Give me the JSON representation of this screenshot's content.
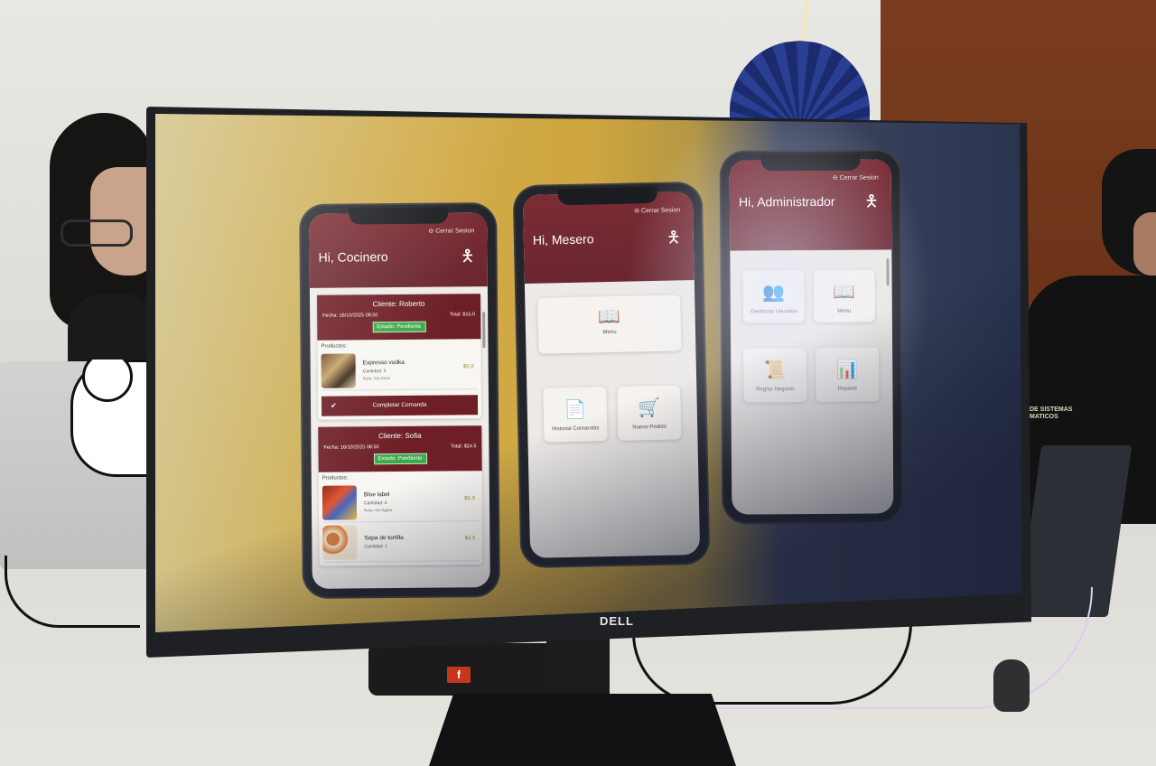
{
  "monitor": {
    "brand": "DELL"
  },
  "speaker": {
    "badge": "f"
  },
  "apparel": {
    "logo_text": "DE SISTEMAS\nMATICOS"
  },
  "phones": {
    "cocinero": {
      "logout": "Cerrar Sesion",
      "greeting": "Hi, Cocinero",
      "orders": [
        {
          "client": "Cliente: Roberto",
          "date": "Fecha: 16/10/2025 08:50",
          "total": "Total: $15.0",
          "status": "Estado: Pendiente",
          "products_label": "Productos:",
          "products": [
            {
              "name": "Expresso vodka",
              "qty": "Cantidad: 3",
              "note": "Nota: Sin limón",
              "price": "$5.0"
            }
          ],
          "complete_label": "Completar Comanda"
        },
        {
          "client": "Cliente: Sofia",
          "date": "Fecha: 16/10/2025 08:50",
          "total": "Total: $24.5",
          "status": "Estado: Pendiente",
          "products_label": "Productos:",
          "products": [
            {
              "name": "Blue label",
              "qty": "Cantidad: 4",
              "note": "Nota: Sin Agitar",
              "price": "$5.0"
            },
            {
              "name": "Sopa de tortilla",
              "qty": "Cantidad: 1",
              "note": "",
              "price": "$4.5"
            }
          ]
        }
      ]
    },
    "mesero": {
      "logout": "Cerrar Sesion",
      "greeting": "Hi, Mesero",
      "tiles": {
        "menu": "Menu",
        "historial": "Historial Comandas",
        "nuevo": "Nuevo Pedido"
      }
    },
    "administrador": {
      "logout": "Cerrar Sesion",
      "greeting": "Hi, Administrador",
      "tiles": {
        "usuarios": "Gestionar Usuarios",
        "menu": "Menu",
        "reglas": "Reglas Negocio",
        "reporte": "Reporte"
      }
    }
  },
  "icons": {
    "wave": "waving-person-icon",
    "menu": "menu-book-icon",
    "historial": "history-document-icon",
    "nuevo": "shopping-cart-icon",
    "usuarios": "users-group-icon",
    "reglas": "scroll-icon",
    "reporte": "report-chart-icon",
    "logout": "logout-icon",
    "complete": "check-icon"
  },
  "colors": {
    "header": "#6e1f26",
    "status": "#3da94a",
    "price": "#8d8a2b"
  }
}
